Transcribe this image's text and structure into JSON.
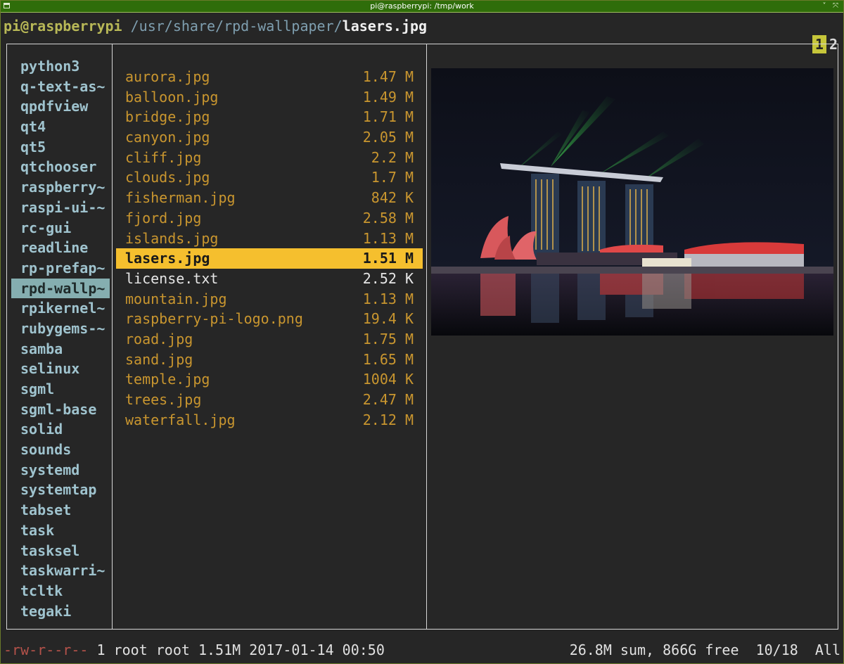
{
  "window": {
    "title": "pi@raspberrypi: /tmp/work",
    "minimize_icon": "˅",
    "maximize_icon": "⤧"
  },
  "pathbar": {
    "user_host": "pi@raspberrypi",
    "directory": "/usr/share/rpd-wallpaper/",
    "file": "lasers.jpg"
  },
  "tabs": [
    {
      "label": "1",
      "active": true
    },
    {
      "label": "2",
      "active": false
    }
  ],
  "parent_dir": {
    "items": [
      "python3",
      "q-text-as~",
      "qpdfview",
      "qt4",
      "qt5",
      "qtchooser",
      "raspberry~",
      "raspi-ui-~",
      "rc-gui",
      "readline",
      "rp-prefap~",
      "rpd-wallp~",
      "rpikernel~",
      "rubygems-~",
      "samba",
      "selinux",
      "sgml",
      "sgml-base",
      "solid",
      "sounds",
      "systemd",
      "systemtap",
      "tabset",
      "task",
      "tasksel",
      "taskwarri~",
      "tcltk",
      "tegaki"
    ],
    "selected_index": 11
  },
  "files": {
    "items": [
      {
        "name": "aurora.jpg",
        "size": "1.47 M"
      },
      {
        "name": "balloon.jpg",
        "size": "1.49 M"
      },
      {
        "name": "bridge.jpg",
        "size": "1.71 M"
      },
      {
        "name": "canyon.jpg",
        "size": "2.05 M"
      },
      {
        "name": "cliff.jpg",
        "size": "2.2 M"
      },
      {
        "name": "clouds.jpg",
        "size": "1.7 M"
      },
      {
        "name": "fisherman.jpg",
        "size": "842 K"
      },
      {
        "name": "fjord.jpg",
        "size": "2.58 M"
      },
      {
        "name": "islands.jpg",
        "size": "1.13 M"
      },
      {
        "name": "lasers.jpg",
        "size": "1.51 M"
      },
      {
        "name": "license.txt",
        "size": "2.52 K"
      },
      {
        "name": "mountain.jpg",
        "size": "1.13 M"
      },
      {
        "name": "raspberry-pi-logo.png",
        "size": "19.4 K"
      },
      {
        "name": "road.jpg",
        "size": "1.75 M"
      },
      {
        "name": "sand.jpg",
        "size": "1.65 M"
      },
      {
        "name": "temple.jpg",
        "size": "1004 K"
      },
      {
        "name": "trees.jpg",
        "size": "2.47 M"
      },
      {
        "name": "waterfall.jpg",
        "size": "2.12 M"
      }
    ],
    "selected_index": 9,
    "plain_index": 10
  },
  "status": {
    "permissions": "-rw-r--r--",
    "info": " 1 root root 1.51M 2017-01-14 00:50",
    "right": "26.8M sum, 866G free  10/18  All"
  },
  "colors": {
    "directory": "#9fc3ce",
    "image_file": "#c9962f",
    "selected_file_bg": "#f5bf2e",
    "selected_dir_bg": "#85aeb0",
    "titlebar": "#2f6d0a"
  }
}
